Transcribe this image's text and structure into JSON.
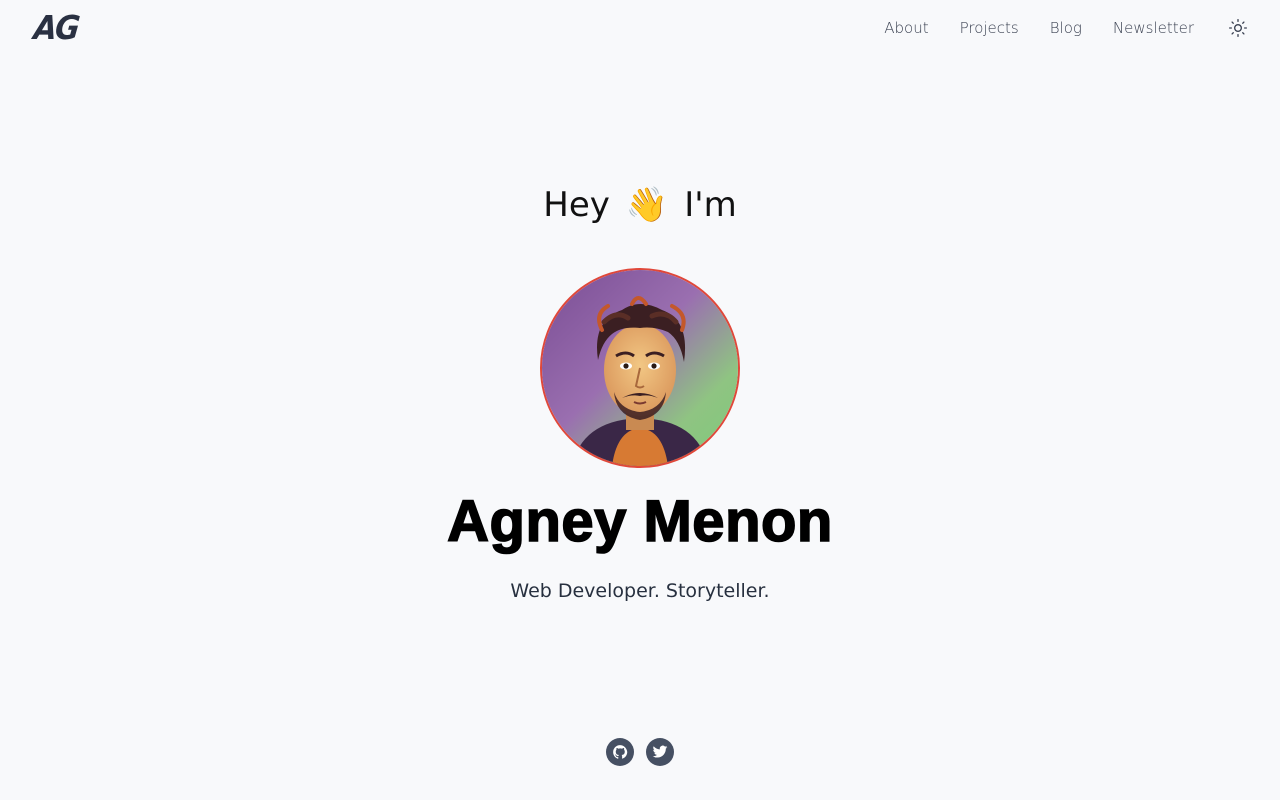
{
  "header": {
    "logo": "AG",
    "nav": [
      {
        "label": "About"
      },
      {
        "label": "Projects"
      },
      {
        "label": "Blog"
      },
      {
        "label": "Newsletter"
      }
    ],
    "theme_toggle_icon": "sun-icon"
  },
  "hero": {
    "greeting_before": "Hey",
    "greeting_emoji": "👋",
    "greeting_after": "I'm",
    "name": "Agney Menon",
    "tagline": "Web Developer. Storyteller.",
    "avatar_icon": "portrait-illustration"
  },
  "social": [
    {
      "icon": "github-icon"
    },
    {
      "icon": "twitter-icon"
    }
  ],
  "colors": {
    "background": "#f8f9fb",
    "avatar_border": "#e0483a",
    "social_icon": "#465063",
    "text": "#1e2533"
  }
}
